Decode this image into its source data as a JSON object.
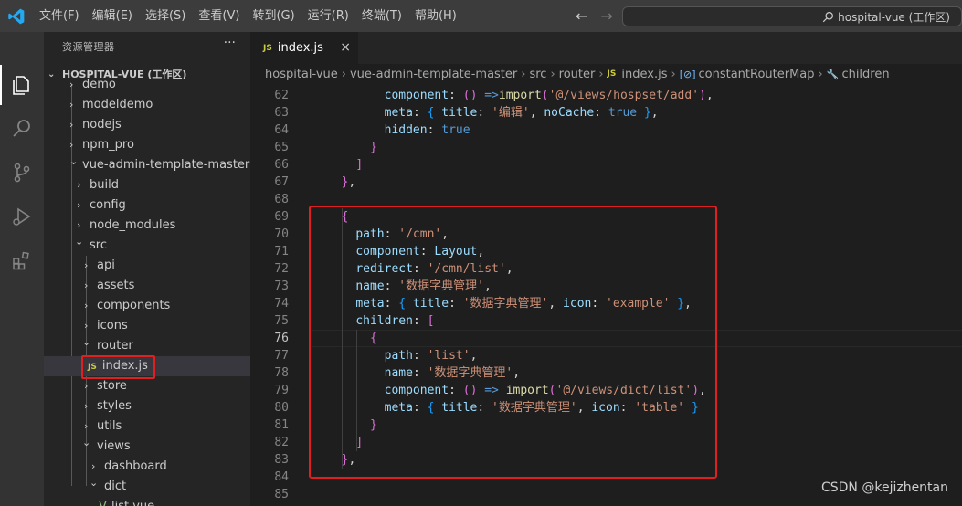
{
  "menu": [
    "文件(F)",
    "编辑(E)",
    "选择(S)",
    "查看(V)",
    "转到(G)",
    "运行(R)",
    "终端(T)",
    "帮助(H)"
  ],
  "title_search": "hospital-vue (工作区)",
  "sidebar": {
    "title": "资源管理器",
    "more": "···",
    "workspace": "HOSPITAL-VUE (工作区)",
    "items": [
      {
        "label": "demo",
        "chev": "›"
      },
      {
        "label": "modeldemo",
        "chev": "›"
      },
      {
        "label": "nodejs",
        "chev": "›"
      },
      {
        "label": "npm_pro",
        "chev": "›"
      },
      {
        "label": "vue-admin-template-master",
        "chev": "⌄"
      },
      {
        "label": "build",
        "chev": "›"
      },
      {
        "label": "config",
        "chev": "›"
      },
      {
        "label": "node_modules",
        "chev": "›"
      },
      {
        "label": "src",
        "chev": "⌄"
      },
      {
        "label": "api",
        "chev": "›"
      },
      {
        "label": "assets",
        "chev": "›"
      },
      {
        "label": "components",
        "chev": "›"
      },
      {
        "label": "icons",
        "chev": "›"
      },
      {
        "label": "router",
        "chev": "⌄"
      },
      {
        "label": "index.js",
        "chev": "",
        "badge": "JS"
      },
      {
        "label": "store",
        "chev": "›"
      },
      {
        "label": "styles",
        "chev": "›"
      },
      {
        "label": "utils",
        "chev": "›"
      },
      {
        "label": "views",
        "chev": "⌄"
      },
      {
        "label": "dashboard",
        "chev": "›"
      },
      {
        "label": "dict",
        "chev": "⌄"
      },
      {
        "label": "list.vue",
        "chev": ""
      }
    ]
  },
  "tab": {
    "badge": "JS",
    "label": "index.js",
    "close": "×"
  },
  "breadcrumb": [
    "hospital-vue",
    "vue-admin-template-master",
    "src",
    "router",
    "index.js",
    "constantRouterMap",
    "children"
  ],
  "code": [
    {
      "n": "62",
      "text": "        component: () =>import('@/views/hospset/add'),"
    },
    {
      "n": "63",
      "text": "        meta: { title: '编辑', noCache: true },"
    },
    {
      "n": "64",
      "text": "        hidden: true"
    },
    {
      "n": "65",
      "text": "      }"
    },
    {
      "n": "66",
      "text": "    ]"
    },
    {
      "n": "67",
      "text": "  },"
    },
    {
      "n": "68",
      "text": ""
    },
    {
      "n": "69",
      "text": "  {"
    },
    {
      "n": "70",
      "text": "    path: '/cmn',"
    },
    {
      "n": "71",
      "text": "    component: Layout,"
    },
    {
      "n": "72",
      "text": "    redirect: '/cmn/list',"
    },
    {
      "n": "73",
      "text": "    name: '数据字典管理',"
    },
    {
      "n": "74",
      "text": "    meta: { title: '数据字典管理', icon: 'example' },"
    },
    {
      "n": "75",
      "text": "    children: ["
    },
    {
      "n": "76",
      "text": "      {"
    },
    {
      "n": "77",
      "text": "        path: 'list',"
    },
    {
      "n": "78",
      "text": "        name: '数据字典管理',"
    },
    {
      "n": "79",
      "text": "        component: () => import('@/views/dict/list'),"
    },
    {
      "n": "80",
      "text": "        meta: { title: '数据字典管理', icon: 'table' }"
    },
    {
      "n": "81",
      "text": "      }"
    },
    {
      "n": "82",
      "text": "    ]"
    },
    {
      "n": "83",
      "text": "  },"
    },
    {
      "n": "84",
      "text": ""
    },
    {
      "n": "85",
      "text": ""
    }
  ],
  "active_line": "76",
  "watermark": "CSDN @kejizhentan"
}
